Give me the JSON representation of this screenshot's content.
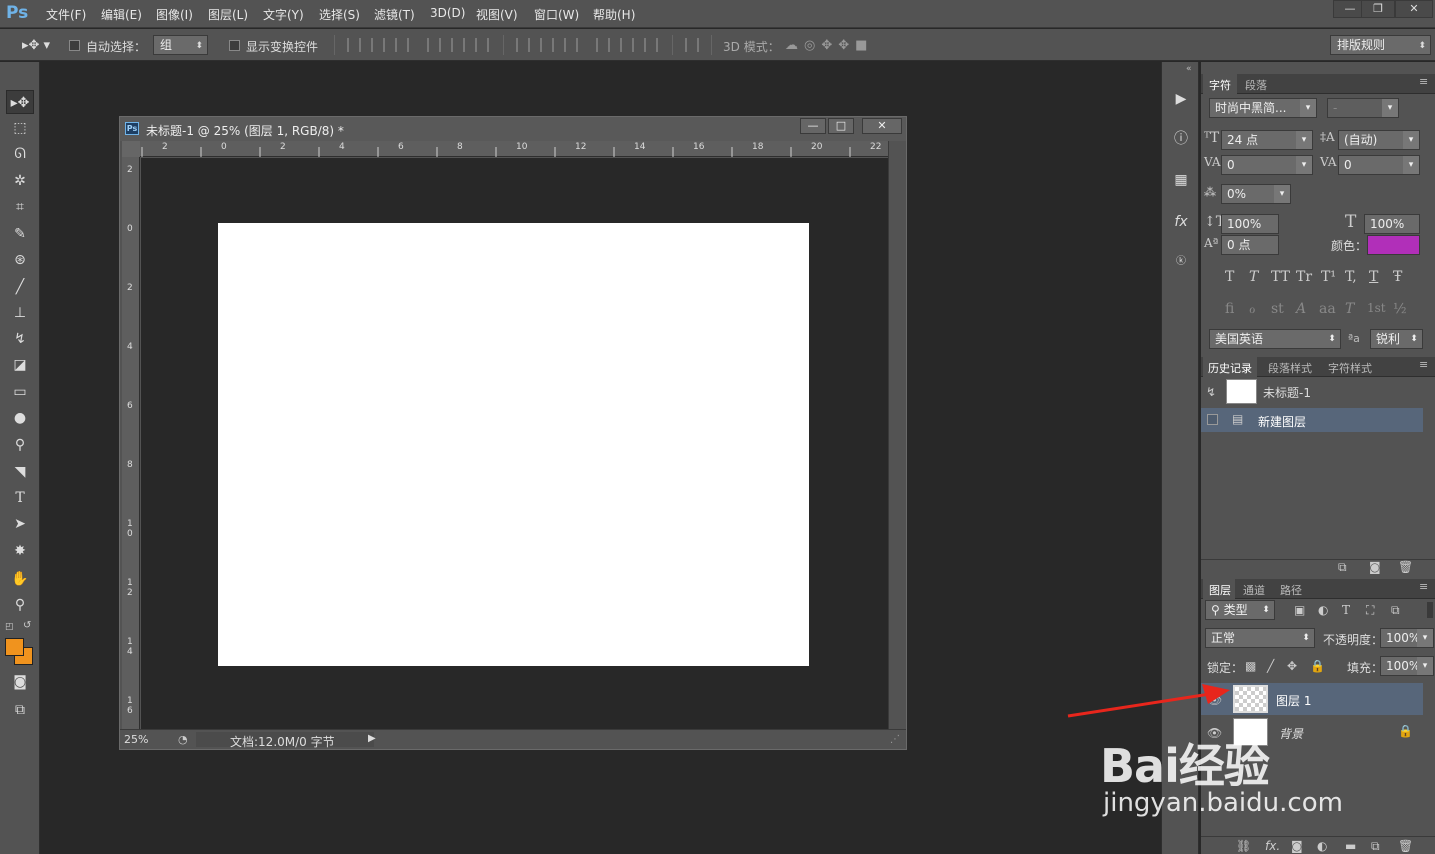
{
  "app": {
    "logo": "Ps"
  },
  "menu": [
    "文件(F)",
    "编辑(E)",
    "图像(I)",
    "图层(L)",
    "文字(Y)",
    "选择(S)",
    "滤镜(T)",
    "3D(D)",
    "视图(V)",
    "窗口(W)",
    "帮助(H)"
  ],
  "window_controls": {
    "minimize": "—",
    "restore": "❐",
    "close": "✕"
  },
  "options": {
    "auto_select_label": "自动选择：",
    "auto_select_value": "组",
    "show_transform_label": "显示变换控件",
    "mode_3d_label": "3D 模式：",
    "workspace": "排版规则"
  },
  "document": {
    "title": "未标题-1 @ 25% (图层 1, RGB/8) *",
    "zoom": "25%",
    "status": "文档:12.0M/0 字节",
    "ruler_top": [
      "2",
      "0",
      "2",
      "4",
      "6",
      "8",
      "10",
      "12",
      "14",
      "16",
      "18",
      "20",
      "22"
    ],
    "ruler_left": [
      "2",
      "0",
      "2",
      "4",
      "6",
      "8",
      "1\n0",
      "1\n2",
      "1\n4",
      "1\n6"
    ]
  },
  "character_panel": {
    "tabs": [
      "字符",
      "段落"
    ],
    "font_family": "时尚中黑简...",
    "font_style": "-",
    "font_size": "24 点",
    "leading": "(自动)",
    "kerning": "0",
    "tracking": "0",
    "tsume": "0%",
    "vertical_scale": "100%",
    "horizontal_scale": "100%",
    "baseline_shift": "0 点",
    "color_label": "颜色：",
    "color": "#b12fb9",
    "language": "美国英语",
    "aa_label": "ªa",
    "antialias": "锐利",
    "type_styles": [
      "T",
      "T",
      "TT",
      "Tr",
      "T¹",
      "T,",
      "T",
      "Ŧ"
    ],
    "opentype": [
      "fi",
      "ℴ",
      "st",
      "A",
      "aa",
      "T",
      "1st",
      "½"
    ]
  },
  "history_panel": {
    "tabs": [
      "历史记录",
      "段落样式",
      "字符样式"
    ],
    "snapshot": "未标题-1",
    "states": [
      "新建图层"
    ]
  },
  "layers_panel": {
    "tabs": [
      "图层",
      "通道",
      "路径"
    ],
    "filter_kind": "类型",
    "blend_mode": "正常",
    "opacity_label": "不透明度：",
    "opacity": "100%",
    "lock_label": "锁定：",
    "fill_label": "填充：",
    "fill": "100%",
    "layers": [
      {
        "name": "图层 1",
        "selected": true
      },
      {
        "name": "背景",
        "selected": false
      }
    ]
  },
  "colors": {
    "foreground": "#f0931e",
    "background": "#f0931e",
    "accent_ps": "#6fb3e8"
  },
  "watermark": {
    "logo": "Bai经验",
    "url": "jingyan.baidu.com"
  }
}
